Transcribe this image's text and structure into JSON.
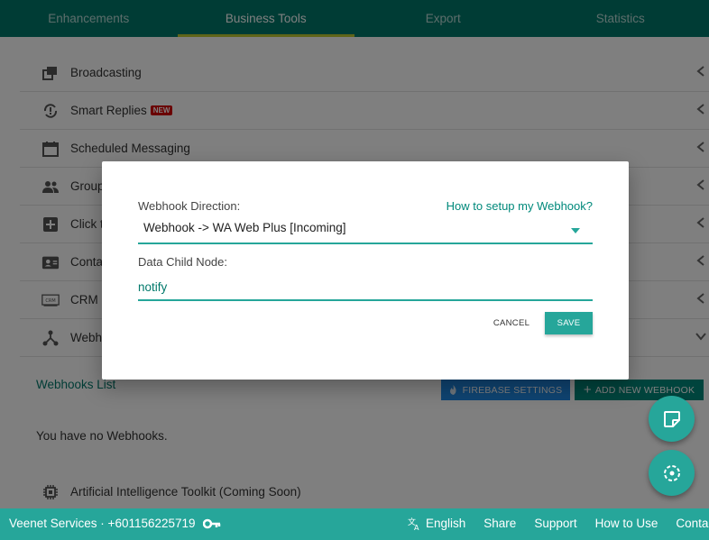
{
  "tabs": [
    "Enhancements",
    "Business Tools",
    "Export",
    "Statistics"
  ],
  "active_tab": "Business Tools",
  "menu": {
    "broadcasting": "Broadcasting",
    "smart_replies": "Smart Replies",
    "smart_replies_badge": "NEW",
    "scheduled": "Scheduled Messaging",
    "groups": "Group",
    "click_to_chat": "Click t",
    "contacts": "Conta",
    "crm": "CRM I",
    "webhooks": "Webho"
  },
  "webhooks": {
    "list_title": "Webhooks List",
    "firebase_button": "FIREBASE SETTINGS",
    "add_button": "ADD NEW WEBHOOK",
    "empty_text": "You have no Webhooks."
  },
  "ai_toolkit": "Artificial Intelligence Toolkit (Coming Soon)",
  "modal": {
    "direction_label": "Webhook Direction:",
    "help_link": "How to setup my Webhook?",
    "direction_value": "Webhook -> WA Web Plus [Incoming]",
    "child_node_label": "Data Child Node:",
    "child_node_value": "notify",
    "cancel": "CANCEL",
    "save": "SAVE"
  },
  "footer": {
    "service": "Veenet Services · +601156225719",
    "language": "English",
    "share": "Share",
    "support": "Support",
    "how_to_use": "How to Use",
    "contact": "Contact"
  },
  "colors": {
    "header": "#00796b",
    "accent": "#26a69a",
    "tab_indicator": "#c0ca33",
    "firebase_blue": "#1e88e5",
    "badge_red": "#d50000"
  }
}
